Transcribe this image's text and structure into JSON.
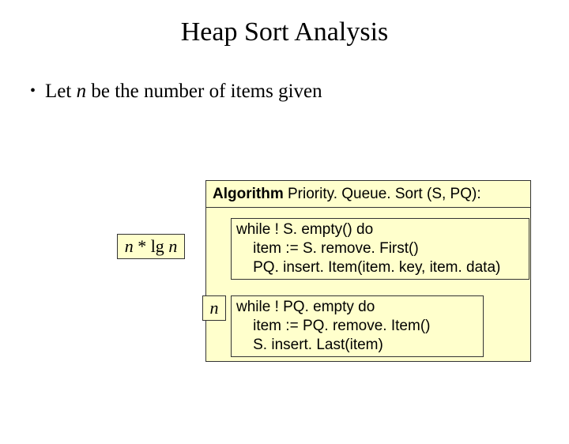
{
  "title": "Heap Sort Analysis",
  "bullet": {
    "prefix": "Let ",
    "var": "n",
    "suffix": " be the number of items given"
  },
  "algorithm": {
    "keyword": "Algorithm",
    "signature": " Priority. Queue. Sort (S, PQ):"
  },
  "block1": {
    "line1": "while ! S. empty() do",
    "line2": "    item := S. remove. First()",
    "line3": "    PQ. insert. Item(item. key, item. data)"
  },
  "block2": {
    "line1": "while ! PQ. empty do",
    "line2": "    item := PQ. remove. Item()",
    "line3": "    S. insert. Last(item)"
  },
  "labels": {
    "nlgn_pre": "n",
    "nlgn_mid": " * lg ",
    "nlgn_post": "n",
    "n": "n"
  }
}
